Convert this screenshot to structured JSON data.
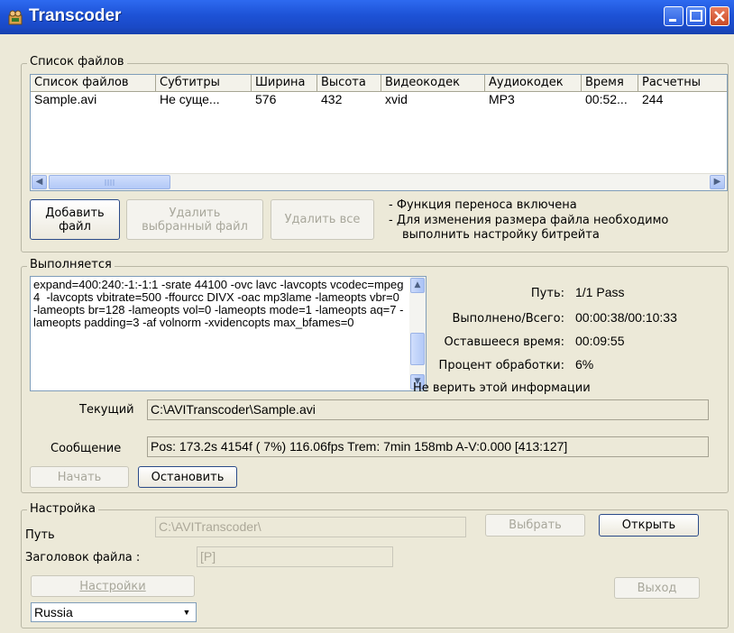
{
  "window": {
    "title": "Transcoder",
    "icon": "transcoder-app-icon"
  },
  "files_group": {
    "legend": "Список файлов",
    "columns": [
      "Список файлов",
      "Субтитры",
      "Ширина",
      "Высота",
      "Видеокодек",
      "Аудиокодек",
      "Время",
      "Расчетны"
    ],
    "rows": [
      [
        "Sample.avi",
        "Не суще...",
        "576",
        "432",
        "xvid",
        "MP3",
        "00:52...",
        "244"
      ]
    ],
    "add_button": "Добавить\nфайл",
    "remove_selected_button": "Удалить\nвыбранный файл",
    "remove_all_button": "Удалить все",
    "notes": [
      "- Функция переноса включена",
      "- Для изменения размера файла необходимо",
      "выполнить настройку битрейта"
    ]
  },
  "progress_group": {
    "legend": "Выполняется",
    "log_text": "expand=400:240:-1:-1:1 -srate 44100 -ovc lavc -lavcopts vcodec=mpeg4  -lavcopts vbitrate=500 -ffourcc DIVX -oac mp3lame -lameopts vbr=0 -lameopts br=128 -lameopts vol=0 -lameopts mode=1 -lameopts aq=7 -lameopts padding=3 -af volnorm -xvidencopts max_bfames=0",
    "stats": {
      "path_label": "Путь:",
      "path_value": "1/1 Pass",
      "done_label": "Выполнено/Всего:",
      "done_value": "00:00:38/00:10:33",
      "remaining_label": "Оставшееся время:",
      "remaining_value": "00:09:55",
      "percent_label": "Процент обработки:",
      "percent_value": "6%",
      "disclaimer": "Не верить этой информации"
    },
    "current_label": "Текущий",
    "current_value": "C:\\AVITranscoder\\Sample.avi",
    "message_label": "Сообщение",
    "message_value": "Pos: 173.2s  4154f ( 7%) 116.06fps Trem:  7min 158mb  A-V:0.000 [413:127]",
    "start_button": "Начать",
    "stop_button": "Остановить"
  },
  "settings_group": {
    "legend": "Настройка",
    "path_label": "Путь",
    "path_value": "C:\\AVITranscoder\\",
    "browse_button": "Выбрать",
    "open_button": "Открыть",
    "header_label": "Заголовок файла :",
    "header_value": "[P]",
    "settings_button": "Настройки",
    "exit_button": "Выход",
    "language": "Russia"
  }
}
